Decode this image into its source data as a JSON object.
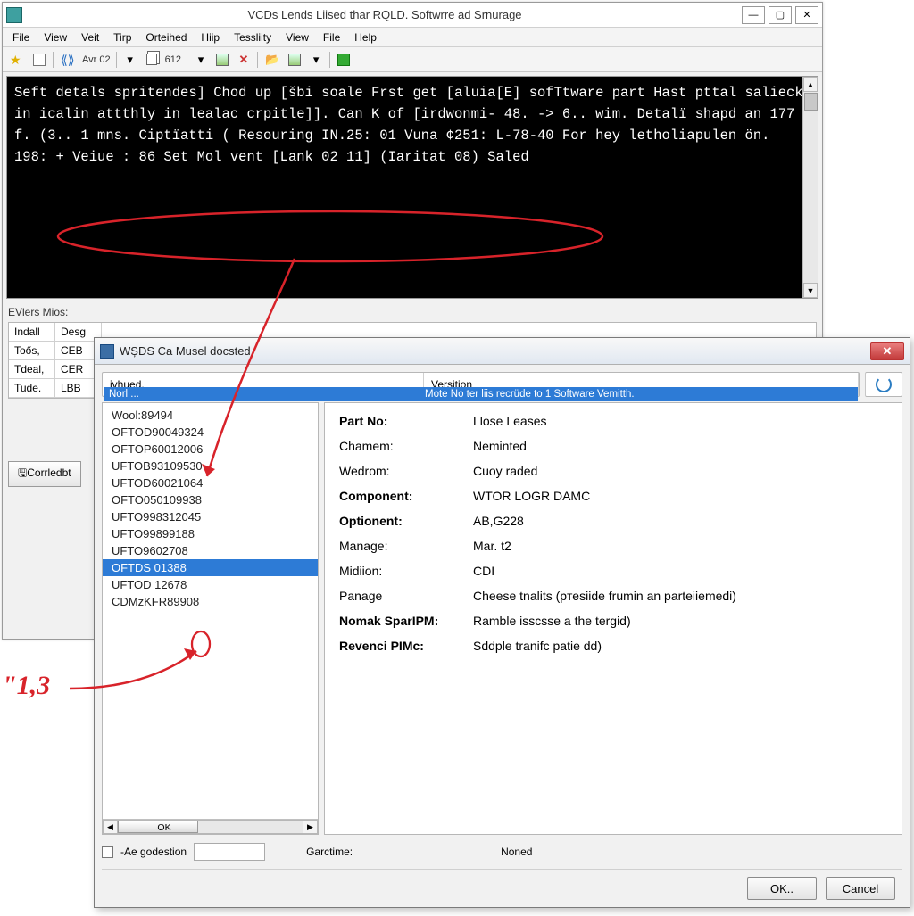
{
  "main": {
    "title": "VCDs Lends Liised thar RQLD. Softwrre ad Srnurage",
    "window_controls": {
      "min": "—",
      "max": "▢",
      "close": "✕"
    },
    "menu": [
      "File",
      "View",
      "Veit",
      "Tirp",
      "Orteihed",
      "Hiip",
      "Tessliity",
      "View",
      "File",
      "Help"
    ],
    "toolbar": {
      "av": "Avr 02",
      "num": "612"
    },
    "console_lines": [
      "Seft detals spritendes]",
      "",
      "Chod up [šbi soale",
      "Frst get [aluia[E] sofTtware part",
      "Hast pttal salieck in icalin attthly in lealac crpitle]].",
      "Can K of [irdwonmi- 48. -> 6.. wim.",
      "Detalï shapd an 177 f. (3.. 1 mns.",
      "",
      "Ciptïatti ( Resouring IN.25: 01 Vuna ¢251: L-78-40",
      "For hey letholiapulen ön. 198: + Veiue : 86",
      "",
      "Set Mol vent [Lank 02 11] (Iaritat 08) Saled"
    ],
    "panel_label": "EVlers Mios:",
    "grid": {
      "col1": [
        "Indall",
        "Toős,",
        "Tdeal,",
        "Tude."
      ],
      "col2": [
        "Desg",
        "CEB",
        "CER",
        "LBB"
      ]
    },
    "connected_btn": "🖫Corrledbt"
  },
  "modal": {
    "title": "WȘDS Ca Musel docsted",
    "header": {
      "col1": "ivhued.",
      "col2": "Versition",
      "sel_left": "Norl ...",
      "sel_right": "Mote No ter liis recrüde to 1 Software Vemitth."
    },
    "list_items": [
      "Wool:89494",
      "OFTOD90049324",
      "OFTOP60012006",
      "UFTOB93109530",
      "UFTOD60021064",
      "OFTO050109938",
      "UFTO998312045",
      "UFTO99899188",
      "UFTO9602708",
      "OFTDS 01388",
      "UFTOD 12678",
      "CDMzKFR89908"
    ],
    "list_selected_index": 9,
    "hs_label": "OK",
    "details": [
      {
        "label": "Part No:",
        "bold": true,
        "value": "Llose Leases"
      },
      {
        "label": "Chamem:",
        "bold": false,
        "value": "Neminted"
      },
      {
        "label": "Wedrom:",
        "bold": false,
        "value": "Cuoy raded"
      },
      {
        "label": "Component:",
        "bold": true,
        "value": "WTOR LOGR DAMC"
      },
      {
        "label": "Optionent:",
        "bold": true,
        "value": "AB,G228"
      },
      {
        "label": "Manage:",
        "bold": false,
        "value": "Mar. t2"
      },
      {
        "label": "Midiion:",
        "bold": false,
        "value": "CDI"
      },
      {
        "label": "Panage",
        "bold": false,
        "value": "Cheese tnalits (pтеsiide frumin an parteiiemedi)"
      },
      {
        "label": "Nomak SparIPM:",
        "bold": true,
        "value": "Ramble isscsse a the tergid)"
      },
      {
        "label": "Revenci PIMс:",
        "bold": true,
        "value": "Sddple tranifс patie dd)"
      }
    ],
    "footer": {
      "chk_label": "-Aе godestion",
      "field2_label": "Garctime:",
      "field2_value": "Noned"
    },
    "buttons": {
      "ok": "OK..",
      "cancel": "Cancel"
    }
  },
  "annotation_text": "\"1,3"
}
